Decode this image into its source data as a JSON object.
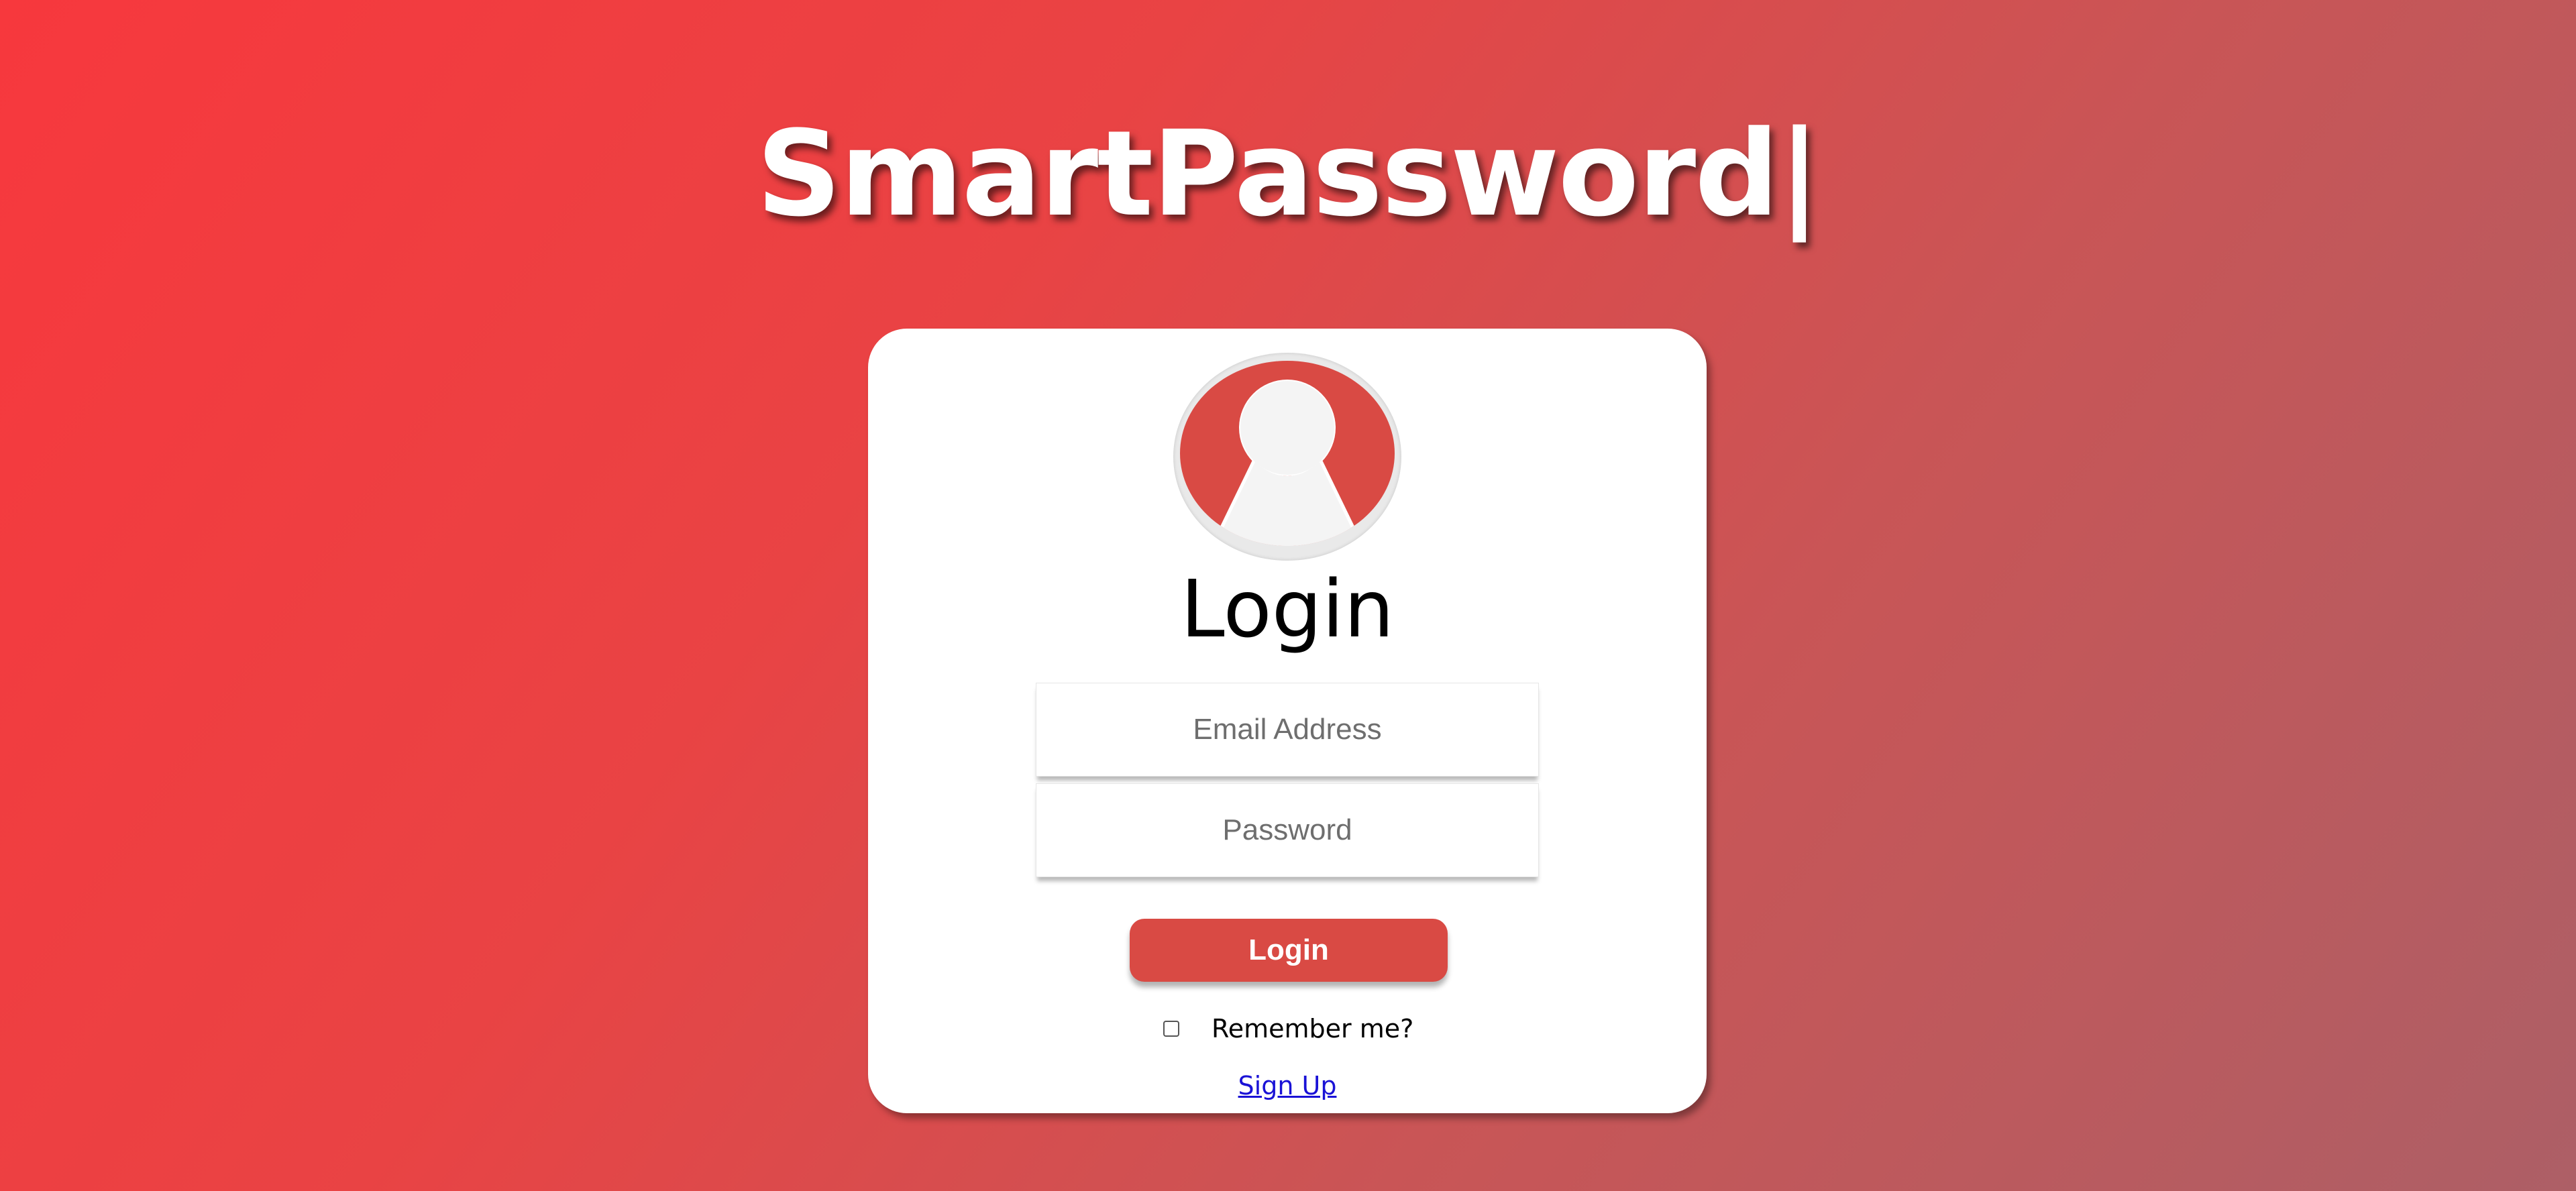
{
  "header": {
    "title": "SmartPassword",
    "cursor": "|"
  },
  "login_card": {
    "avatar_icon": "user-silhouette-icon",
    "heading": "Login",
    "email_placeholder": "Email Address",
    "email_value": "",
    "password_placeholder": "Password",
    "password_value": "",
    "login_button_label": "Login",
    "remember_label": "Remember me?",
    "remember_checked": false,
    "signup_link": "Sign Up"
  },
  "colors": {
    "background_start": "#f7383d",
    "background_end": "#ad5f66",
    "accent": "#d94a44",
    "link": "#1a12d6"
  }
}
